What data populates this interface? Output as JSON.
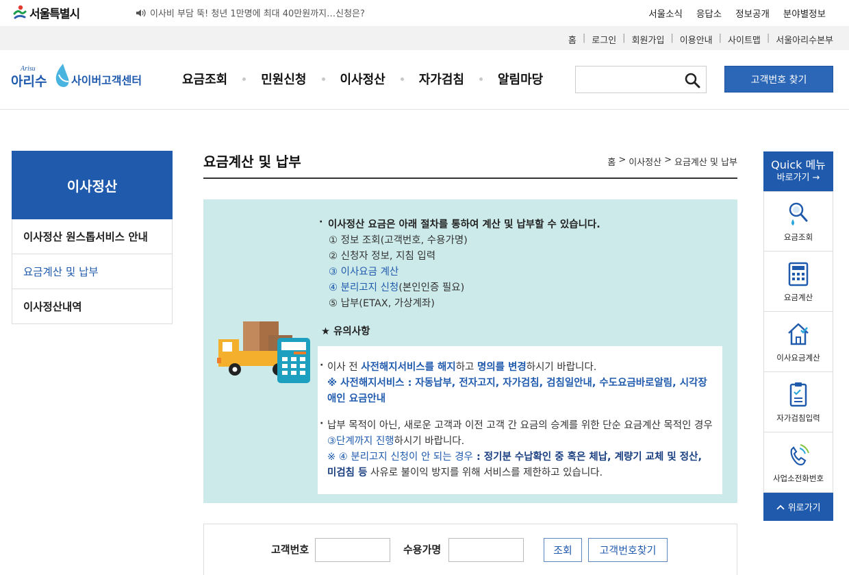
{
  "topbar": {
    "city_name": "서울특별시",
    "notice": "이사비 부담 뚝! 청년 1만명에 최대 40만원까지…신청은?",
    "links": [
      "서울소식",
      "응답소",
      "정보공개",
      "분야별정보"
    ]
  },
  "utility": {
    "links": [
      "홈",
      "로그인",
      "회원가입",
      "이용안내",
      "사이트맵",
      "서울아리수본부"
    ]
  },
  "header": {
    "logo_small": "Arisu",
    "logo_brand": "아리수",
    "logo_title": "사이버고객센터",
    "nav": [
      "요금조회",
      "민원신청",
      "이사정산",
      "자가검침",
      "알림마당"
    ],
    "search_placeholder": "",
    "find_button": "고객번호 찾기"
  },
  "sidebar": {
    "title": "이사정산",
    "items": [
      {
        "label": "이사정산 원스톱서비스 안내",
        "active": false
      },
      {
        "label": "요금계산 및 납부",
        "active": true
      },
      {
        "label": "이사정산내역",
        "active": false
      }
    ]
  },
  "content": {
    "title": "요금계산 및 납부",
    "breadcrumb": [
      "홈",
      ">",
      "이사정산",
      ">",
      "요금계산 및 납부"
    ],
    "lead": "이사정산 요금은 아래 절차를 통하여 계산 및 납부할 수 있습니다.",
    "steps": [
      "① 정보 조회(고객번호, 수용가명)",
      "② 신청자 정보, 지침 입력",
      "③ 이사요금 계산",
      "④ 분리고지 신청",
      "(본인인증 필요)",
      "⑤ 납부(ETAX, 가상계좌)"
    ],
    "caution_title": "★ 유의사항",
    "caution1": {
      "t1": "이사 전 ",
      "t2": "사전해지서비스를 해지",
      "t3": "하고 ",
      "t4": "명의를 변경",
      "t5": "하시기 바랍니다.",
      "note": "※ 사전해지서비스 : 자동납부, 전자고지, 자가검침, 검침일안내, 수도요금바로알림, 시각장애인 요금안내"
    },
    "caution2": {
      "t1": "납부 목적이 아닌, 새로운 고객과 이전 고객 간 요금의 승계를 위한 단순 요금계산 목적인 경우 ",
      "t2": "③단계까지 진행",
      "t3": "하시기 바랍니다.",
      "n1": "※ ",
      "n2": "④ 분리고지 신청이 안 되는 경우",
      "n3": " : 정기분 수납확인 중 혹은 체납, 계량기 교체 및 정산, 미검침 등",
      "n4": " 사유로 불이익 방지를 위해 서비스를 제한하고 있습니다."
    }
  },
  "form": {
    "customer_no_label": "고객번호",
    "customer_no_value": "",
    "name_label": "수용가명",
    "name_value": "",
    "search_button": "조회",
    "find_button": "고객번호찾기"
  },
  "quick": {
    "title": "Quick 메뉴",
    "subtitle": "바로가기 →",
    "items": [
      "요금조회",
      "요금계산",
      "이사요금계산",
      "자가검침입력",
      "사업소전화번호"
    ],
    "top_button": "위로가기"
  },
  "colors": {
    "primary": "#1f5aad",
    "button": "#2b67b6",
    "info_bg": "#cdeaea",
    "util_bg": "#f2f2f2"
  }
}
